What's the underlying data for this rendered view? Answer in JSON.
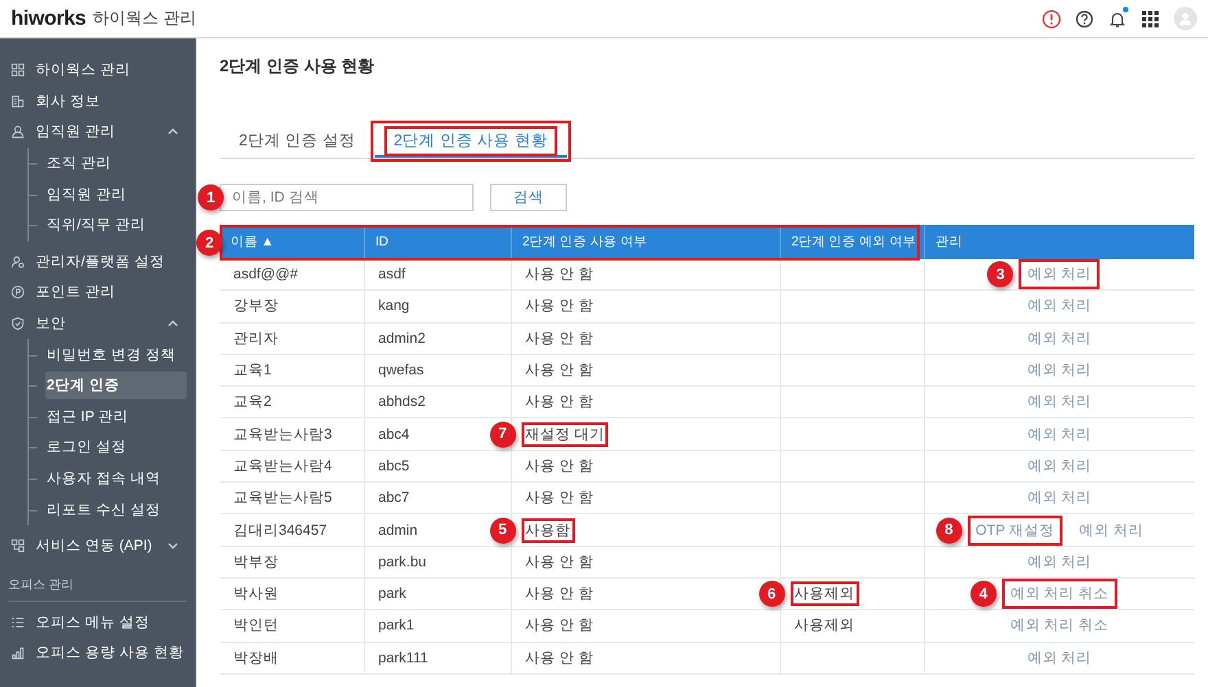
{
  "header": {
    "logo": "hiworks",
    "title": "하이웍스 관리",
    "has_unread_notification": true
  },
  "sidebar": {
    "sections": [
      {
        "items": [
          {
            "label": "하이웍스 관리"
          },
          {
            "label": "회사 정보"
          },
          {
            "label": "임직원 관리",
            "expanded": true,
            "children": [
              {
                "label": "조직 관리",
                "selected": false
              },
              {
                "label": "임직원 관리",
                "selected": false
              },
              {
                "label": "직위/직무 관리",
                "selected": false
              }
            ]
          },
          {
            "label": "관리자/플랫폼 설정"
          },
          {
            "label": "포인트 관리"
          },
          {
            "label": "보안",
            "expanded": true,
            "children": [
              {
                "label": "비밀번호 변경 정책",
                "selected": false
              },
              {
                "label": "2단계 인증",
                "selected": true
              },
              {
                "label": "접근 IP 관리",
                "selected": false
              },
              {
                "label": "로그인 설정",
                "selected": false
              },
              {
                "label": "사용자 접속 내역",
                "selected": false
              },
              {
                "label": "리포트 수신 설정",
                "selected": false
              }
            ]
          },
          {
            "label": "서비스 연동 (API)",
            "expanded": false
          }
        ]
      },
      {
        "label": "오피스 관리",
        "items": [
          {
            "label": "오피스 메뉴 설정"
          },
          {
            "label": "오피스 용량 사용 현황"
          }
        ]
      }
    ]
  },
  "page_title": "2단계 인증 사용 현황",
  "tabs": [
    {
      "label": "2단계 인증 설정",
      "selected": false,
      "highlighted": false
    },
    {
      "label": "2단계 인증 사용 현황",
      "selected": true,
      "highlighted": true
    }
  ],
  "search": {
    "placeholder": "이름, ID 검색",
    "button": "검색",
    "callout": "1"
  },
  "table": {
    "header_callout": "2",
    "columns": [
      {
        "label": "이름",
        "sort_icon": "▲"
      },
      {
        "label": "ID"
      },
      {
        "label": "2단계 인증 사용 여부"
      },
      {
        "label": "2단계 인증 예외 여부"
      },
      {
        "label": "관리"
      }
    ],
    "rows": [
      {
        "name": "asdf@@#",
        "id": "asdf",
        "status": "사용 안 함",
        "actions": [
          {
            "label": "예외 처리",
            "callout": "3"
          }
        ]
      },
      {
        "name": "강부장",
        "id": "kang",
        "status": "사용 안 함",
        "actions": [
          {
            "label": "예외 처리"
          }
        ]
      },
      {
        "name": "관리자",
        "id": "admin2",
        "status": "사용 안 함",
        "actions": [
          {
            "label": "예외 처리"
          }
        ]
      },
      {
        "name": "교육1",
        "id": "qwefas",
        "status": "사용 안 함",
        "actions": [
          {
            "label": "예외 처리"
          }
        ]
      },
      {
        "name": "교육2",
        "id": "abhds2",
        "status": "사용 안 함",
        "actions": [
          {
            "label": "예외 처리"
          }
        ]
      },
      {
        "name": "교육받는사람3",
        "id": "abc4",
        "status": "재설정 대기",
        "status_callout": "7",
        "actions": [
          {
            "label": "예외 처리"
          }
        ]
      },
      {
        "name": "교육받는사람4",
        "id": "abc5",
        "status": "사용 안 함",
        "actions": [
          {
            "label": "예외 처리"
          }
        ]
      },
      {
        "name": "교육받는사람5",
        "id": "abc7",
        "status": "사용 안 함",
        "actions": [
          {
            "label": "예외 처리"
          }
        ]
      },
      {
        "name": "김대리346457",
        "id": "admin",
        "status": "사용함",
        "status_callout": "5",
        "actions": [
          {
            "label": "OTP 재설정",
            "callout": "8"
          },
          {
            "label": "예외 처리"
          }
        ]
      },
      {
        "name": "박부장",
        "id": "park.bu",
        "status": "사용 안 함",
        "actions": [
          {
            "label": "예외 처리"
          }
        ]
      },
      {
        "name": "박사원",
        "id": "park",
        "status": "사용 안 함",
        "exception": "사용제외",
        "exception_callout": "6",
        "actions": [
          {
            "label": "예외 처리 취소",
            "callout": "4"
          }
        ]
      },
      {
        "name": "박인턴",
        "id": "park1",
        "status": "사용 안 함",
        "exception": "사용제외",
        "actions": [
          {
            "label": "예외 처리 취소"
          }
        ]
      },
      {
        "name": "박장배",
        "id": "park111",
        "status": "사용 안 함",
        "actions": [
          {
            "label": "예외 처리"
          }
        ]
      }
    ]
  }
}
